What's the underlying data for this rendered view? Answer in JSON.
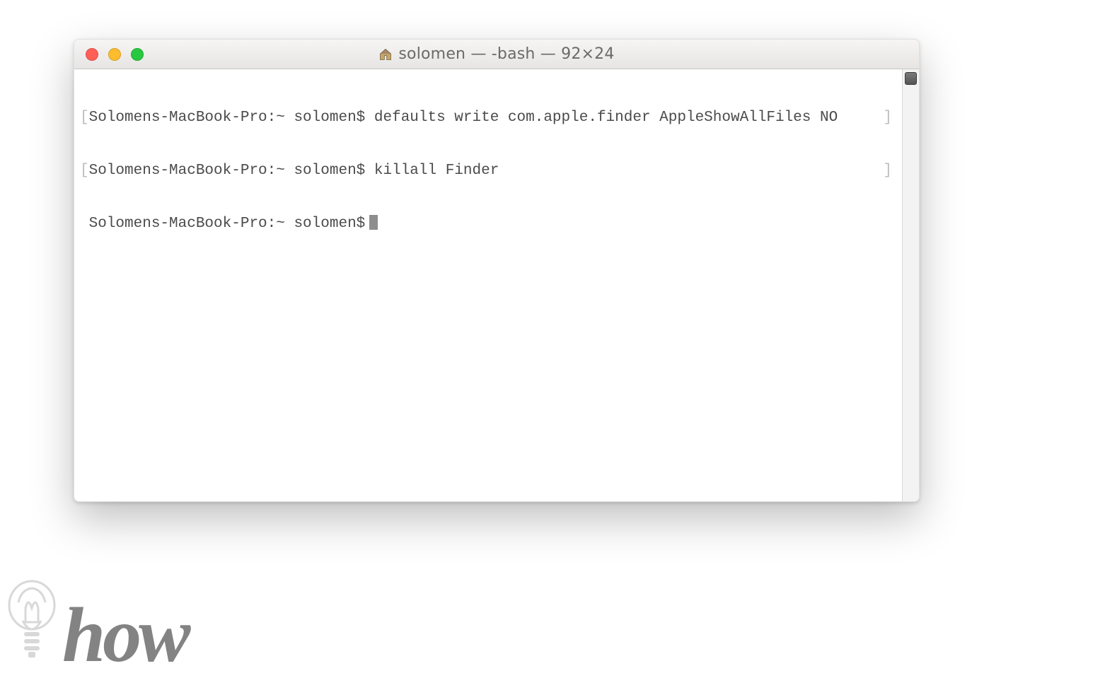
{
  "window": {
    "title": "solomen — -bash — 92×24"
  },
  "terminal": {
    "prompt": "Solomens-MacBook-Pro:~ solomen$",
    "lines": [
      {
        "command": "defaults write com.apple.finder AppleShowAllFiles NO"
      },
      {
        "command": "killall Finder"
      }
    ]
  },
  "watermark": {
    "text": "how"
  }
}
